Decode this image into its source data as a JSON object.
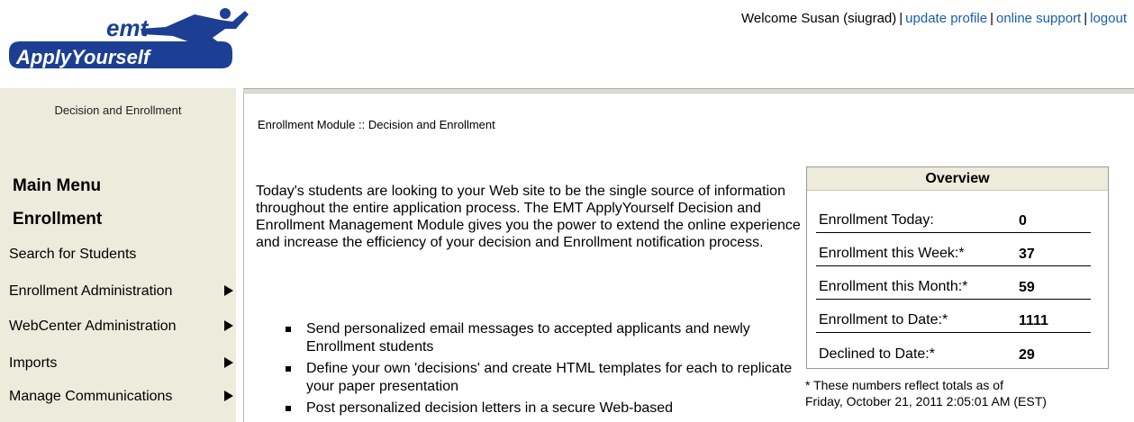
{
  "header": {
    "logo_emt": "emt",
    "logo_text": "ApplyYourself",
    "welcome": "Welcome Susan (siugrad)",
    "links": [
      "update profile",
      "online support",
      "logout"
    ]
  },
  "sidebar": {
    "caption": "Decision and Enrollment",
    "main_menu": "Main Menu",
    "section": "Enrollment",
    "items": [
      {
        "label": "Search for Students"
      },
      {
        "label": "Enrollment Administration"
      },
      {
        "label": "WebCenter Administration"
      },
      {
        "label": "Imports"
      },
      {
        "label": "Manage Communications"
      }
    ]
  },
  "main": {
    "breadcrumb": "Enrollment Module :: Decision and Enrollment",
    "intro": "Today's students are looking to your Web site to be the single source of information throughout the entire application process. The EMT ApplyYourself Decision and Enrollment Management Module gives you the power to extend the online experience and increase the efficiency of your decision and Enrollment notification process.",
    "bullets": [
      "Send personalized email messages to accepted applicants and newly Enrollment students",
      "Define your own 'decisions' and create HTML templates for each to replicate your paper presentation",
      "Post personalized decision letters in a secure Web-based"
    ]
  },
  "overview": {
    "title": "Overview",
    "rows": [
      {
        "label": "Enrollment Today:",
        "value": "0"
      },
      {
        "label": "Enrollment this Week:*",
        "value": "37"
      },
      {
        "label": "Enrollment this Month:*",
        "value": "59"
      },
      {
        "label": "Enrollment to Date:*",
        "value": "1111"
      },
      {
        "label": "Declined to Date:*",
        "value": "29"
      }
    ],
    "note_line1": "* These numbers reflect totals as of",
    "note_line2": "Friday, October 21, 2011 2:05:01 AM (EST)"
  },
  "colors": {
    "link": "#1a5db1",
    "logo_blue": "#1c3f94",
    "sidebar_bg": "#ecebdc"
  }
}
